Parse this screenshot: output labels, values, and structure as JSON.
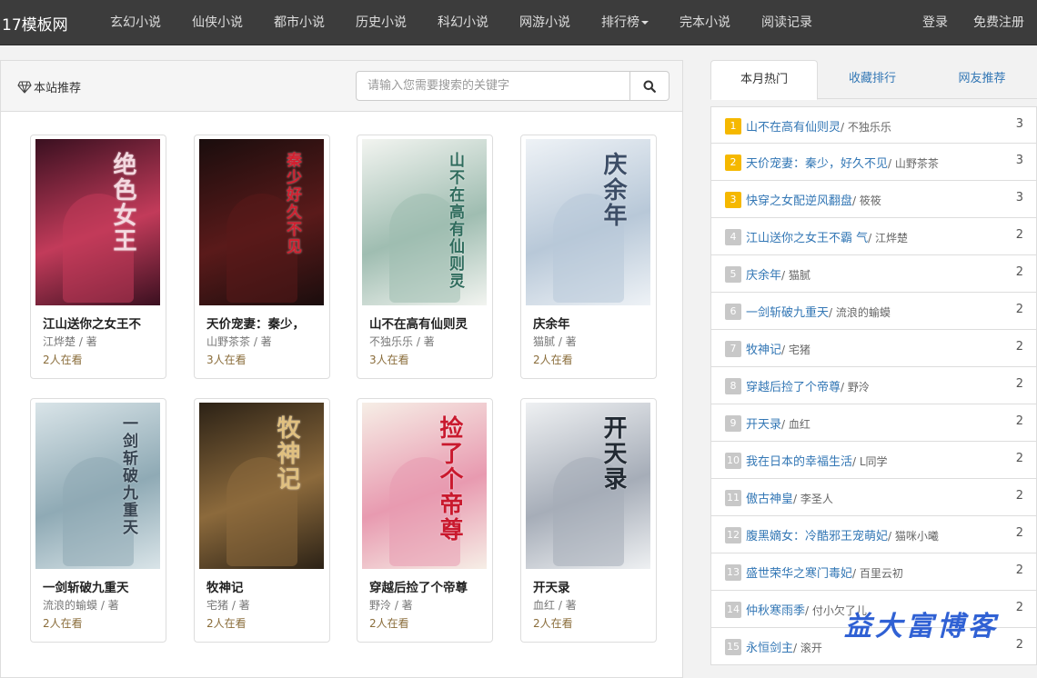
{
  "brand": "17模板网",
  "nav": {
    "links": [
      "玄幻小说",
      "仙侠小说",
      "都市小说",
      "历史小说",
      "科幻小说",
      "网游小说",
      "排行榜",
      "完本小说",
      "阅读记录"
    ],
    "login": "登录",
    "register": "免费注册"
  },
  "main": {
    "section_title": "本站推荐",
    "search": {
      "placeholder": "请输入您需要搜索的关键字"
    },
    "books": [
      {
        "name": "江山送你之女王不",
        "author": "江烨楚 / 著",
        "readers": "2人在看",
        "cover_text": "绝色女王",
        "cover_colors": [
          "#3a1020",
          "#c23b5a",
          "#f4d9e0"
        ]
      },
      {
        "name": "天价宠妻：秦少，",
        "author": "山野茶茶 / 著",
        "readers": "3人在看",
        "cover_text": "秦少好久不见",
        "cover_colors": [
          "#1a0d0d",
          "#5a1a1a",
          "#d41f2f"
        ]
      },
      {
        "name": "山不在高有仙则灵",
        "author": "不独乐乐 / 著",
        "readers": "3人在看",
        "cover_text": "山不在高有仙则灵",
        "cover_colors": [
          "#f2f4f0",
          "#9fbdb1",
          "#2e6b5c"
        ]
      },
      {
        "name": "庆余年",
        "author": "猫腻 / 著",
        "readers": "2人在看",
        "cover_text": "庆余年",
        "cover_colors": [
          "#eef2f6",
          "#b8c8d8",
          "#3c4d66"
        ]
      },
      {
        "name": "一剑斩破九重天",
        "author": "流浪的蝓蟆 / 著",
        "readers": "2人在看",
        "cover_text": "一剑斩破九重天",
        "cover_colors": [
          "#d9e4e8",
          "#8faab5",
          "#35424f"
        ]
      },
      {
        "name": "牧神记",
        "author": "宅猪 / 著",
        "readers": "2人在看",
        "cover_text": "牧神记",
        "cover_colors": [
          "#2c2216",
          "#8c6a3c",
          "#e0c080"
        ]
      },
      {
        "name": "穿越后捡了个帝尊",
        "author": "野泠 / 著",
        "readers": "2人在看",
        "cover_text": "捡了个帝尊",
        "cover_colors": [
          "#f6eee6",
          "#e89ab0",
          "#c9192e"
        ]
      },
      {
        "name": "开天录",
        "author": "血红 / 著",
        "readers": "2人在看",
        "cover_text": "开天录",
        "cover_colors": [
          "#eef0f2",
          "#a6adb8",
          "#222a33"
        ]
      }
    ]
  },
  "side": {
    "tabs": [
      "本月热门",
      "收藏排行",
      "网友推荐"
    ],
    "ranking": [
      {
        "rank": "1",
        "title": "山不在高有仙则灵",
        "author": "/ 不独乐乐",
        "count": "3"
      },
      {
        "rank": "2",
        "title": "天价宠妻：秦少，好久不见",
        "author": "/ 山野茶茶",
        "count": "3"
      },
      {
        "rank": "3",
        "title": "快穿之女配逆风翻盘",
        "author": "/ 筱筱",
        "count": "3"
      },
      {
        "rank": "4",
        "title": "江山送你之女王不霸 气",
        "author": "/ 江烨楚",
        "count": "2"
      },
      {
        "rank": "5",
        "title": "庆余年",
        "author": "/ 猫腻",
        "count": "2"
      },
      {
        "rank": "6",
        "title": "一剑斩破九重天",
        "author": "/ 流浪的蝓蟆",
        "count": "2"
      },
      {
        "rank": "7",
        "title": "牧神记",
        "author": "/ 宅猪",
        "count": "2"
      },
      {
        "rank": "8",
        "title": "穿越后捡了个帝尊",
        "author": "/ 野泠",
        "count": "2"
      },
      {
        "rank": "9",
        "title": "开天录",
        "author": "/ 血红",
        "count": "2"
      },
      {
        "rank": "10",
        "title": "我在日本的幸福生活",
        "author": "/ L同学",
        "count": "2"
      },
      {
        "rank": "11",
        "title": "傲古神皇",
        "author": "/ 李圣人",
        "count": "2"
      },
      {
        "rank": "12",
        "title": "腹黑嫡女：冷酷邪王宠萌妃",
        "author": "/ 猫咪小曦",
        "count": "2"
      },
      {
        "rank": "13",
        "title": "盛世荣华之寒门毒妃",
        "author": "/ 百里云初",
        "count": "2"
      },
      {
        "rank": "14",
        "title": "仲秋寒雨季",
        "author": "/ 付小欠了儿",
        "count": "2"
      },
      {
        "rank": "15",
        "title": "永恒剑主",
        "author": "/ 滚开",
        "count": "2"
      }
    ]
  },
  "watermark": "益大富博客",
  "colors": {
    "navbar": "#3c3c3c",
    "link": "#3377b5",
    "top_rank": "#f5b800",
    "rank": "#c8c8c8"
  }
}
